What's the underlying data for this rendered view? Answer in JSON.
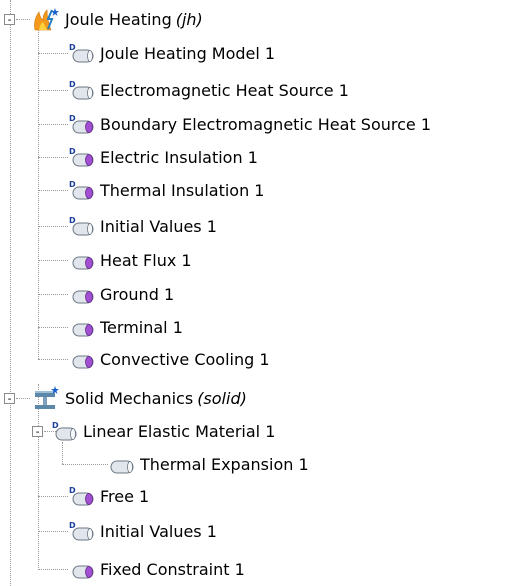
{
  "tree": {
    "joule": {
      "label": "Joule Heating",
      "tag": "(jh)",
      "expander": "-",
      "icon": "joule-heating-physics-icon",
      "children": [
        {
          "label": "Joule Heating Model 1",
          "icon": "domain-node-default-icon"
        },
        {
          "label": "Electromagnetic Heat Source 1",
          "icon": "domain-node-default-icon"
        },
        {
          "label": "Boundary Electromagnetic Heat Source 1",
          "icon": "boundary-node-default-icon"
        },
        {
          "label": "Electric Insulation 1",
          "icon": "boundary-node-default-icon"
        },
        {
          "label": "Thermal Insulation 1",
          "icon": "boundary-node-default-icon"
        },
        {
          "label": "Initial Values 1",
          "icon": "domain-node-default-icon"
        },
        {
          "label": "Heat Flux 1",
          "icon": "boundary-node-icon"
        },
        {
          "label": "Ground 1",
          "icon": "boundary-node-icon"
        },
        {
          "label": "Terminal 1",
          "icon": "boundary-node-icon"
        },
        {
          "label": "Convective Cooling 1",
          "icon": "boundary-node-icon"
        }
      ]
    },
    "solid": {
      "label": "Solid Mechanics",
      "tag": "(solid)",
      "expander": "-",
      "icon": "solid-mechanics-physics-icon",
      "children": [
        {
          "label": "Linear Elastic Material 1",
          "icon": "domain-node-default-icon",
          "expander": "-",
          "children": [
            {
              "label": "Thermal Expansion 1",
              "icon": "subnode-icon"
            }
          ]
        },
        {
          "label": "Free 1",
          "icon": "boundary-node-default-icon"
        },
        {
          "label": "Initial Values 1",
          "icon": "domain-node-default-icon"
        },
        {
          "label": "Fixed Constraint 1",
          "icon": "boundary-node-icon"
        }
      ]
    }
  },
  "colors": {
    "guide": "#9a9a9a",
    "domain_icon": "#cfd6de",
    "boundary_icon": "#a050d0",
    "physics_blue": "#2a7fc0"
  }
}
